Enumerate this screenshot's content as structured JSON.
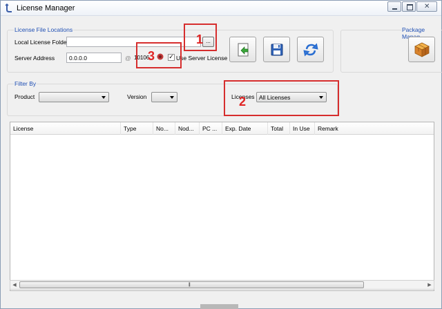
{
  "window": {
    "title": "License Manager",
    "icon": "key-icon"
  },
  "locations": {
    "group_label": "License File Locations",
    "local_folder_label": "Local License Folder",
    "local_folder_value": "",
    "browse_label": "...",
    "server_label": "Server Address",
    "server_value": "0.0.0.0",
    "at_symbol": "@",
    "port_value": "10106",
    "use_server_checked": true,
    "use_server_label": "Use Server License"
  },
  "toolbar": {
    "import_icon": "import-license-icon",
    "save_icon": "save-disk-icon",
    "refresh_icon": "refresh-icon"
  },
  "package": {
    "label": "Package Manag",
    "icon": "package-box-icon"
  },
  "filter": {
    "group_label": "Filter By",
    "product_label": "Product",
    "product_value": "",
    "version_label": "Version",
    "version_value": "",
    "licenses_label": "Licenses",
    "licenses_value": "All Licenses"
  },
  "annotations": [
    "1",
    "2",
    "3"
  ],
  "grid": {
    "columns": [
      "License",
      "Type",
      "No...",
      "Nod...",
      "PC ...",
      "Exp. Date",
      "Total",
      "In Use",
      "Remark"
    ],
    "rows": []
  },
  "colors": {
    "annotation_red": "#d62d2d",
    "group_label_blue": "#1f4fb4"
  }
}
